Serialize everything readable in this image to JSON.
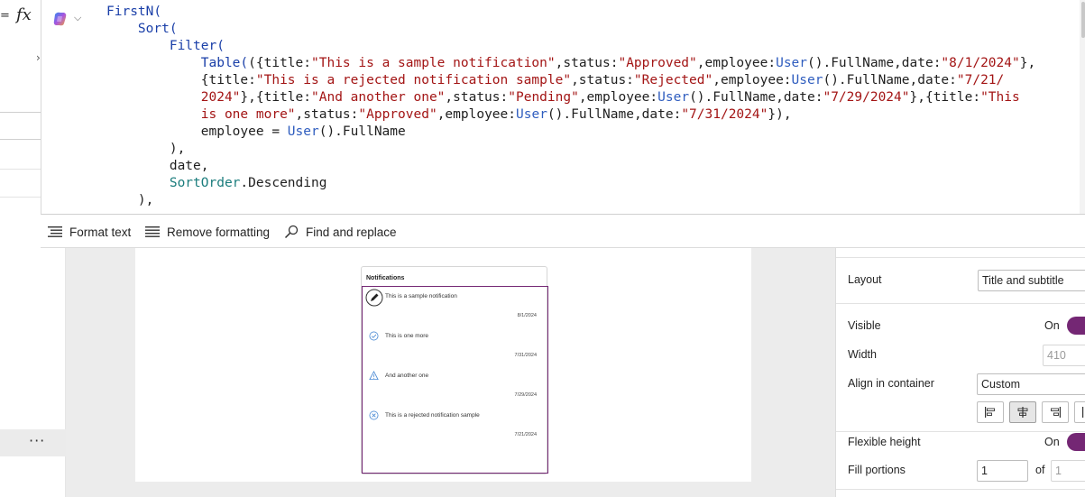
{
  "formula_bar": {
    "equals": "=",
    "fx": "fx",
    "code_lines": [
      [
        [
          "fn",
          "FirstN("
        ]
      ],
      [
        [
          "p",
          "    "
        ],
        [
          "fn",
          "Sort("
        ]
      ],
      [
        [
          "p",
          "        "
        ],
        [
          "fn",
          "Filter("
        ]
      ],
      [
        [
          "p",
          "            "
        ],
        [
          "fn",
          "Table("
        ],
        [
          "p",
          "({title:"
        ],
        [
          "str",
          "\"This is a sample notification\""
        ],
        [
          "p",
          ",status:"
        ],
        [
          "str",
          "\"Approved\""
        ],
        [
          "p",
          ",employee:"
        ],
        [
          "user",
          "User"
        ],
        [
          "p",
          "().FullName,date:"
        ],
        [
          "str",
          "\"8/1/2024\""
        ],
        [
          "p",
          "},"
        ]
      ],
      [
        [
          "p",
          "            {title:"
        ],
        [
          "str",
          "\"This is a rejected notification sample\""
        ],
        [
          "p",
          ",status:"
        ],
        [
          "str",
          "\"Rejected\""
        ],
        [
          "p",
          ",employee:"
        ],
        [
          "user",
          "User"
        ],
        [
          "p",
          "().FullName,date:"
        ],
        [
          "str",
          "\"7/21/"
        ]
      ],
      [
        [
          "p",
          "            "
        ],
        [
          "str",
          "2024\""
        ],
        [
          "p",
          "},{title:"
        ],
        [
          "str",
          "\"And another one\""
        ],
        [
          "p",
          ",status:"
        ],
        [
          "str",
          "\"Pending\""
        ],
        [
          "p",
          ",employee:"
        ],
        [
          "user",
          "User"
        ],
        [
          "p",
          "().FullName,date:"
        ],
        [
          "str",
          "\"7/29/2024\""
        ],
        [
          "p",
          "},{title:"
        ],
        [
          "str",
          "\"This"
        ]
      ],
      [
        [
          "p",
          "            "
        ],
        [
          "str",
          "is one more\""
        ],
        [
          "p",
          ",status:"
        ],
        [
          "str",
          "\"Approved\""
        ],
        [
          "p",
          ",employee:"
        ],
        [
          "user",
          "User"
        ],
        [
          "p",
          "().FullName,date:"
        ],
        [
          "str",
          "\"7/31/2024\""
        ],
        [
          "p",
          "}),"
        ]
      ],
      [
        [
          "p",
          "            employee = "
        ],
        [
          "user",
          "User"
        ],
        [
          "p",
          "().FullName"
        ]
      ],
      [
        [
          "p",
          "        ),"
        ]
      ],
      [
        [
          "p",
          "        date,"
        ]
      ],
      [
        [
          "p",
          "        "
        ],
        [
          "enum",
          "SortOrder"
        ],
        [
          "p",
          ".Descending"
        ]
      ],
      [
        [
          "p",
          "    ),"
        ]
      ]
    ]
  },
  "toolbar": {
    "format_text": "Format text",
    "remove_formatting": "Remove formatting",
    "find_replace": "Find and replace"
  },
  "left_panel": {
    "more_label": "···"
  },
  "notifications": {
    "header": "Notifications",
    "items": [
      {
        "title": "This is a sample notification",
        "date": "8/1/2024",
        "status": "edit"
      },
      {
        "title": "This is one more",
        "date": "7/31/2024",
        "status": "approved"
      },
      {
        "title": "And another one",
        "date": "7/29/2024",
        "status": "pending"
      },
      {
        "title": "This is a rejected notification sample",
        "date": "7/21/2024",
        "status": "rejected"
      }
    ]
  },
  "properties": {
    "layout_label": "Layout",
    "layout_value": "Title and subtitle",
    "visible_label": "Visible",
    "visible_value": "On",
    "width_label": "Width",
    "width_value": "410",
    "align_label": "Align in container",
    "align_value": "Custom",
    "flexible_label": "Flexible height",
    "flexible_value": "On",
    "fill_label": "Fill portions",
    "fill_value": "1",
    "fill_of": "of",
    "fill_total": "1",
    "accent_color": "#742774"
  }
}
